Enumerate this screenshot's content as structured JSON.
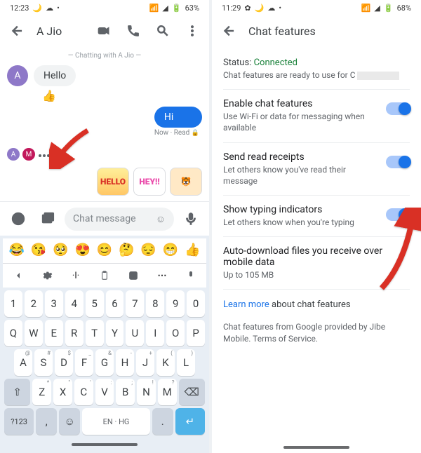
{
  "left": {
    "status": {
      "time": "12:23",
      "battery": "63%"
    },
    "appbar": {
      "title": "A Jio"
    },
    "info_banner": "— Chatting with A Jio —",
    "messages": {
      "incoming_avatar": "A",
      "incoming_text": "Hello",
      "reaction": "👍",
      "outgoing_text": "Hi",
      "meta": "Now · Read",
      "typing_initials": {
        "a": "A",
        "m": "M"
      }
    },
    "stickers": {
      "hello": "HELLO",
      "hey": "HEY!!",
      "wave": "🐯"
    },
    "compose": {
      "placeholder": "Chat message"
    },
    "emojis": [
      "😂",
      "😘",
      "🥺",
      "😍",
      "😊",
      "🤔",
      "😔",
      "😁",
      "👍"
    ],
    "keyboard": {
      "row_num": [
        "1",
        "2",
        "3",
        "4",
        "5",
        "6",
        "7",
        "8",
        "9",
        "0"
      ],
      "row_q": [
        "Q",
        "W",
        "E",
        "R",
        "T",
        "Y",
        "U",
        "I",
        "O",
        "P"
      ],
      "row_a": [
        "A",
        "S",
        "D",
        "F",
        "G",
        "H",
        "J",
        "K",
        "L"
      ],
      "row_a_sup": [
        "@",
        "#",
        "$",
        "_",
        "&",
        "-",
        "+",
        "(",
        ")"
      ],
      "row_z": [
        "Z",
        "X",
        "C",
        "V",
        "B",
        "N",
        "M"
      ],
      "row_z_sup": [
        "*",
        "\"",
        "'",
        ":",
        ";",
        "!",
        "?"
      ],
      "sym": "?123",
      "lang": "EN · HG"
    }
  },
  "right": {
    "status": {
      "time": "11:29",
      "battery": "68%"
    },
    "appbar": {
      "title": "Chat features"
    },
    "status_label": "Status:",
    "status_value": "Connected",
    "ready_text_prefix": "Chat features are ready to use for C",
    "settings": {
      "enable": {
        "title": "Enable chat features",
        "sub": "Use Wi-Fi or data for messaging when available"
      },
      "receipts": {
        "title": "Send read receipts",
        "sub": "Let others know you've read their message"
      },
      "typing": {
        "title": "Show typing indicators",
        "sub": "Let others know when you're typing"
      },
      "auto": {
        "title": "Auto-download files you receive over mobile data",
        "sub": "Up to 105 MB"
      }
    },
    "learn_more": "Learn more",
    "learn_more_suffix": " about chat features",
    "footer": "Chat features from Google provided by Jibe Mobile. Terms of Service."
  }
}
